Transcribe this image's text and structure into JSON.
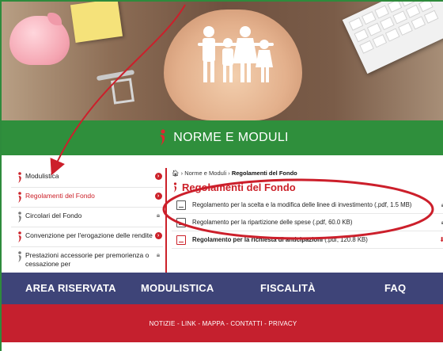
{
  "hero": {
    "image": "hands-holding-paper-family"
  },
  "header": {
    "title": "NORME E MODULI",
    "logo_icon": "red-figure-logo-icon"
  },
  "sidebar": {
    "items": [
      {
        "label": "Modulistica",
        "icon": "arrow-circle-icon",
        "active": false
      },
      {
        "label": "Regolamenti del Fondo",
        "icon": "arrow-circle-icon",
        "active": true
      },
      {
        "label": "Circolari del Fondo",
        "icon": "lock-icon",
        "active": false
      },
      {
        "label": "Convenzione per l'erogazione delle rendite",
        "icon": "arrow-circle-icon",
        "active": false
      },
      {
        "label": "Prestazioni accessorie per premorienza o cessazione per",
        "icon": "lock-icon",
        "active": false
      }
    ]
  },
  "breadcrumb": {
    "home_icon": "home-icon",
    "sep": "›",
    "parent": "Norme e Moduli",
    "current": "Regolamenti del Fondo"
  },
  "page": {
    "title": "Regolamenti del Fondo"
  },
  "documents": [
    {
      "name": "Regolamento per la scelta e la modifica delle linee di investimento",
      "meta": "(.pdf, 1.5 MB)",
      "action": "lock-icon"
    },
    {
      "name": "Regolamento per la ripartizione delle spese",
      "meta": "(.pdf, 60.0 KB)",
      "action": "lock-icon"
    },
    {
      "name": "Regolamento per la richiesta di anticipazioni",
      "meta": "(.pdf, 120.8 KB)",
      "action": "download-icon"
    }
  ],
  "nav": {
    "items": [
      "AREA RISERVATA",
      "MODULISTICA",
      "FISCALITÀ",
      "FAQ"
    ]
  },
  "footer": {
    "links": [
      "NOTIZIE",
      "LINK",
      "MAPPA",
      "CONTATTI",
      "PRIVACY"
    ],
    "sep": " - "
  },
  "colors": {
    "green": "#2f8f3c",
    "red": "#cc2129",
    "navy": "#3e4478",
    "footer_red": "#c5202e"
  }
}
